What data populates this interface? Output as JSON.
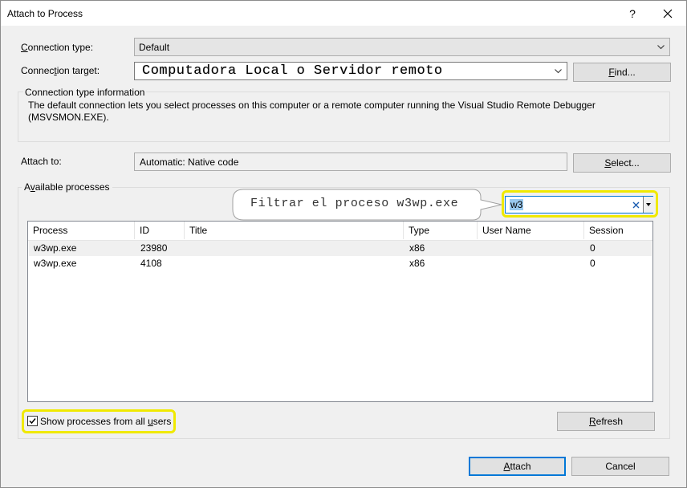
{
  "window": {
    "title": "Attach to Process",
    "help_label": "?",
    "close_label": "✕"
  },
  "connection": {
    "type_label": "Connection type:",
    "type_value": "Default",
    "target_label": "Connection target:",
    "target_value": "Computadora Local o Servidor remoto",
    "find_label": "Find...",
    "info_title": "Connection type information",
    "info_text": "The default connection lets you select processes on this computer or a remote computer running the Visual Studio Remote Debugger (MSVSMON.EXE)."
  },
  "attach_to": {
    "label": "Attach to:",
    "value": "Automatic: Native code",
    "select_label": "Select..."
  },
  "processes": {
    "group_label": "Available processes",
    "callout": "Filtrar el proceso w3wp.exe",
    "filter_value": "w3",
    "columns": [
      "Process",
      "ID",
      "Title",
      "Type",
      "User Name",
      "Session"
    ],
    "rows": [
      [
        "w3wp.exe",
        "23980",
        "",
        "x86",
        "",
        "0"
      ],
      [
        "w3wp.exe",
        "4108",
        "",
        "x86",
        "",
        "0"
      ]
    ],
    "show_all_label": "Show processes from all users",
    "show_all_checked": true,
    "refresh_label": "Refresh"
  },
  "footer": {
    "attach_label": "Attach",
    "cancel_label": "Cancel"
  },
  "colors": {
    "highlight": "#f0e900",
    "selection": "#99c9ef",
    "accent": "#0078d7"
  }
}
